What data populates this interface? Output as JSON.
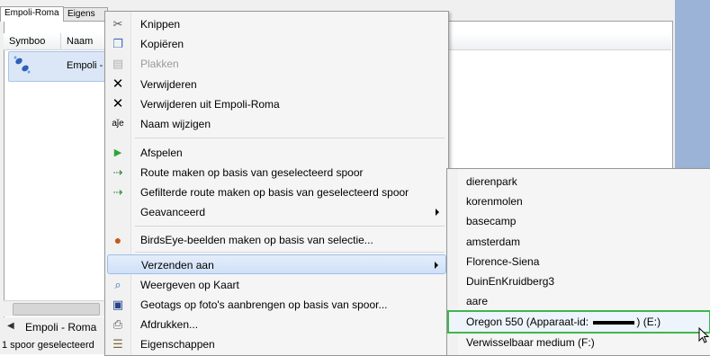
{
  "tabs": [
    {
      "label": "Empoli-Roma",
      "active": true
    },
    {
      "label": "Eigens",
      "active": false
    }
  ],
  "columns": [
    "Symboo",
    "Naam"
  ],
  "list": {
    "row_text": "Empoli -",
    "row_icon": "track-icon"
  },
  "navigator": {
    "text": "Empoli - Roma",
    "arrow": "◀"
  },
  "status": {
    "text": "1 spoor geselecteerd"
  },
  "context_menu": {
    "items": [
      {
        "label": "Knippen",
        "icon": "scissors-icon",
        "glyph": "✂"
      },
      {
        "label": "Kopiëren",
        "icon": "copy-icon",
        "glyph": "❐"
      },
      {
        "label": "Plakken",
        "icon": "paste-icon",
        "glyph": "▤",
        "disabled": true
      },
      {
        "label": "Verwijderen",
        "icon": "delete-icon",
        "glyph": "✕"
      },
      {
        "label": "Verwijderen uit Empoli-Roma",
        "icon": "remove-icon",
        "glyph": "✕"
      },
      {
        "label": "Naam wijzigen",
        "icon": "rename-icon",
        "glyph": "aǰe"
      },
      {
        "label": "Afspelen",
        "icon": "play-icon",
        "glyph": "▶"
      },
      {
        "label": "Route maken op basis van geselecteerd spoor",
        "icon": "route-icon",
        "glyph": "⇢"
      },
      {
        "label": "Gefilterde route maken op basis van geselecteerd spoor",
        "icon": "filtered-route-icon",
        "glyph": "⇢"
      },
      {
        "label": "Geavanceerd",
        "icon": "",
        "glyph": "",
        "submenu": true
      },
      {
        "label": "BirdsEye-beelden maken op basis van selectie...",
        "icon": "birdseye-icon",
        "glyph": "●"
      },
      {
        "label": "Verzenden aan",
        "icon": "",
        "glyph": "",
        "submenu": true,
        "highlighted": true
      },
      {
        "label": "Weergeven op Kaart",
        "icon": "map-icon",
        "glyph": "⌕"
      },
      {
        "label": "Geotags op foto's aanbrengen op basis van spoor...",
        "icon": "geotag-icon",
        "glyph": "▣"
      },
      {
        "label": "Afdrukken...",
        "icon": "print-icon",
        "glyph": "⎙"
      },
      {
        "label": "Eigenschappen",
        "icon": "properties-icon",
        "glyph": "☰"
      }
    ]
  },
  "send_to_submenu": {
    "items": [
      {
        "label": "dierenpark"
      },
      {
        "label": "korenmolen"
      },
      {
        "label": "basecamp"
      },
      {
        "label": "amsterdam"
      },
      {
        "label": "Florence-Siena"
      },
      {
        "label": "DuinEnKruidberg3"
      },
      {
        "label": "aare"
      },
      {
        "label_prefix": "Oregon 550 (Apparaat-id: ",
        "label_suffix": ") (E:)",
        "selected": true
      },
      {
        "label": "Verwisselbaar medium (F:)"
      }
    ]
  },
  "colors": {
    "accent_strip": "#9ab3d6",
    "selection_outline": "#3fb64b",
    "highlight": "#cfe0f7"
  }
}
